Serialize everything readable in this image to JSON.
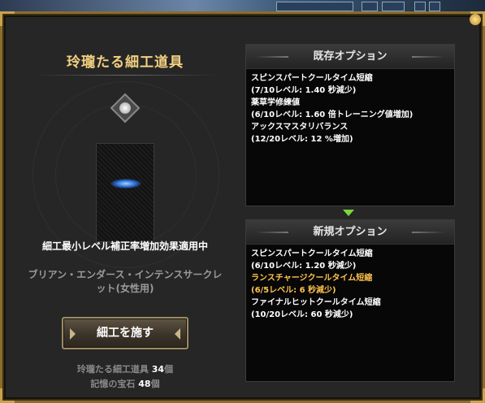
{
  "window": {
    "title": "玲瓏たる細工道具",
    "effect_text": "細工最小レベル補正率増加効果適用中",
    "item_name": "ブリアン・エンダース・インテンスサークレット(女性用)",
    "craft_button": "細工を施す",
    "inventory": [
      {
        "label": "玲瓏たる細工道具",
        "count": "34",
        "unit": "個"
      },
      {
        "label": "記憶の宝石",
        "count": "48",
        "unit": "個"
      }
    ]
  },
  "existing": {
    "header": "既存オプション",
    "lines": [
      {
        "text": "スピンスパートクールタイム短縮",
        "highlight": false
      },
      {
        "text": "(7/10レベル: 1.40 秒減少)",
        "highlight": false
      },
      {
        "text": "薬草学修練値",
        "highlight": false
      },
      {
        "text": "(6/10レベル: 1.60 倍トレーニング値増加)",
        "highlight": false
      },
      {
        "text": "アックスマスタリバランス",
        "highlight": false
      },
      {
        "text": "(12/20レベル: 12 %増加)",
        "highlight": false
      }
    ]
  },
  "new": {
    "header": "新規オプション",
    "lines": [
      {
        "text": "スピンスパートクールタイム短縮",
        "highlight": false
      },
      {
        "text": "(6/10レベル: 1.20 秒減少)",
        "highlight": false
      },
      {
        "text": "ランスチャージクールタイム短縮",
        "highlight": true
      },
      {
        "text": "(6/5レベル: 6 秒減少)",
        "highlight": true
      },
      {
        "text": "ファイナルヒットクールタイム短縮",
        "highlight": false
      },
      {
        "text": "(10/20レベル: 60 秒減少)",
        "highlight": false
      }
    ]
  },
  "colors": {
    "title_gold": "#f2d080",
    "highlight": "#ffc34d",
    "arrow_green": "#7dd63a"
  }
}
